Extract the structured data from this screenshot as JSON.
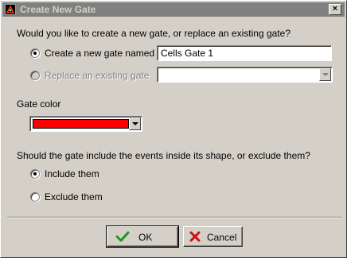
{
  "window": {
    "title": "Create New Gate",
    "close_glyph": "×"
  },
  "question1": "Would you like to create a new gate, or replace an existing gate?",
  "create_option": {
    "label": "Create a new gate named",
    "selected": true,
    "value": "Cells Gate 1"
  },
  "replace_option": {
    "label": "Replace an existing gate",
    "selected": false,
    "enabled": false,
    "value": ""
  },
  "gate_color": {
    "label": "Gate color",
    "swatch_color": "#ff0000"
  },
  "question2": "Should the gate include the events inside its shape, or exclude them?",
  "include_option": {
    "label": "Include them",
    "selected": true
  },
  "exclude_option": {
    "label": "Exclude them",
    "selected": false
  },
  "buttons": {
    "ok": {
      "label": "OK",
      "icon": "checkmark-icon",
      "icon_color": "#1a9a1a"
    },
    "cancel": {
      "label": "Cancel",
      "icon": "x-mark-icon",
      "icon_color": "#cc1111"
    }
  }
}
